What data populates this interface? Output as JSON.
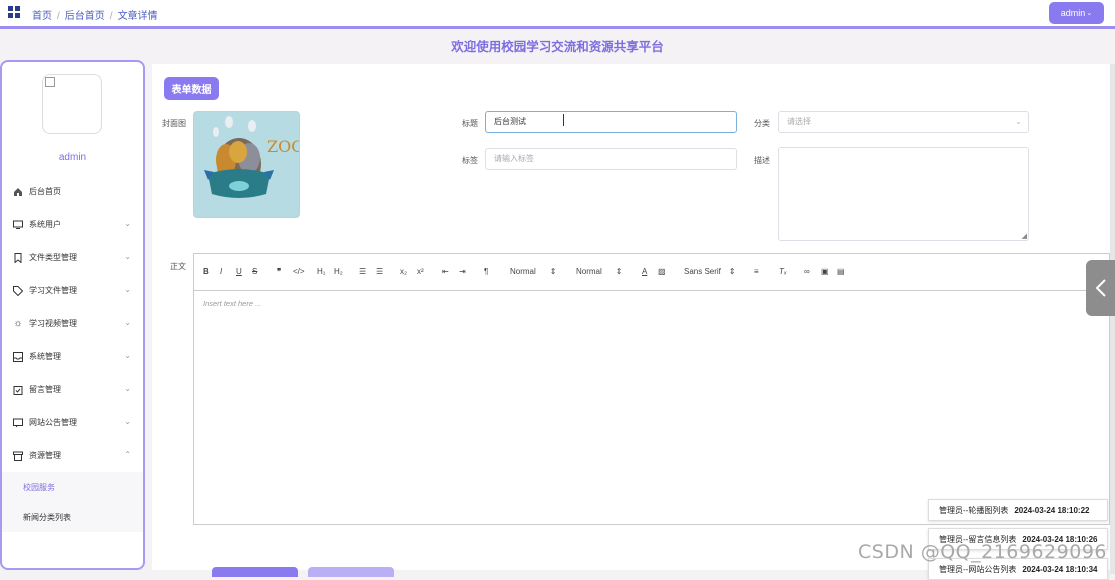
{
  "header": {
    "breadcrumbs": [
      "首页",
      "后台首页",
      "文章详情"
    ],
    "admin_label": "admin"
  },
  "banner_title": "欢迎使用校园学习交流和资源共享平台",
  "sidebar": {
    "username": "admin",
    "items": [
      {
        "label": "后台首页",
        "icon": "home-icon",
        "has_chevron": false
      },
      {
        "label": "系统用户",
        "icon": "monitor-icon",
        "has_chevron": true
      },
      {
        "label": "文件类型管理",
        "icon": "bookmark-icon",
        "has_chevron": true
      },
      {
        "label": "学习文件管理",
        "icon": "tag-icon",
        "has_chevron": true
      },
      {
        "label": "学习视频管理",
        "icon": "sun-icon",
        "has_chevron": true
      },
      {
        "label": "系统管理",
        "icon": "inbox-icon",
        "has_chevron": true
      },
      {
        "label": "留言管理",
        "icon": "clipboard-icon",
        "has_chevron": true
      },
      {
        "label": "网站公告管理",
        "icon": "chat-icon",
        "has_chevron": true
      },
      {
        "label": "资源管理",
        "icon": "archive-icon",
        "has_chevron": true,
        "expanded": true
      }
    ],
    "subitems": [
      {
        "label": "校园服务",
        "active": true
      },
      {
        "label": "新闻分类列表",
        "active": false
      }
    ]
  },
  "form": {
    "section_tag": "表单数据",
    "cover_label": "封面图",
    "cover_image_text": "ZOO",
    "title_label": "标题",
    "title_value": "后台测试",
    "category_label": "分类",
    "category_placeholder": "请选择",
    "tags_label": "标签",
    "tags_placeholder": "请输入标签",
    "desc_label": "描述",
    "body_label": "正文",
    "editor_placeholder": "Insert text here ...",
    "toolbar": {
      "size1": "Normal",
      "size2": "Normal",
      "font": "Sans Serif"
    }
  },
  "toasts": [
    {
      "text": "管理员--轮播图列表",
      "time": "2024-03-24 18:10:22"
    },
    {
      "text": "管理员--留言信息列表",
      "time": "2024-03-24 18:10:26"
    },
    {
      "text": "管理员--网站公告列表",
      "time": "2024-03-24 18:10:34"
    }
  ],
  "watermark": "CSDN @QQ_2169629096",
  "colors": {
    "accent": "#8a7af0",
    "title": "#7d6ee0"
  }
}
